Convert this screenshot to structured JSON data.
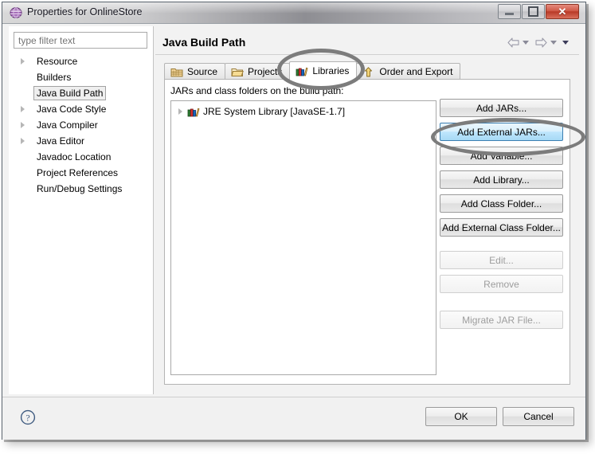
{
  "window": {
    "title": "Properties for OnlineStore",
    "icon": "properties-sphere-icon",
    "controls": {
      "minimize": "minimize-button",
      "maximize": "maximize-button",
      "close_glyph": "✕"
    }
  },
  "sidebar": {
    "filter": {
      "placeholder": "type filter text",
      "value": ""
    },
    "items": [
      {
        "label": "Resource",
        "expandable": true,
        "selected": false
      },
      {
        "label": "Builders",
        "expandable": false,
        "selected": false
      },
      {
        "label": "Java Build Path",
        "expandable": false,
        "selected": true
      },
      {
        "label": "Java Code Style",
        "expandable": true,
        "selected": false
      },
      {
        "label": "Java Compiler",
        "expandable": true,
        "selected": false
      },
      {
        "label": "Java Editor",
        "expandable": true,
        "selected": false
      },
      {
        "label": "Javadoc Location",
        "expandable": false,
        "selected": false
      },
      {
        "label": "Project References",
        "expandable": false,
        "selected": false
      },
      {
        "label": "Run/Debug Settings",
        "expandable": false,
        "selected": false
      }
    ]
  },
  "main": {
    "page_title": "Java Build Path",
    "nav": {
      "back_icon": "back-arrow-icon",
      "back_menu_icon": "chevron-down-icon",
      "forward_icon": "forward-arrow-icon",
      "forward_menu_icon": "chevron-down-icon",
      "view_menu_icon": "view-menu-chevron-icon"
    },
    "tabs": [
      {
        "label": "Source",
        "icon": "source-folder-icon",
        "active": false
      },
      {
        "label": "Projects",
        "icon": "project-folder-icon",
        "active": false
      },
      {
        "label": "Libraries",
        "icon": "libraries-books-icon",
        "active": true
      },
      {
        "label": "Order and Export",
        "icon": "order-export-icon",
        "active": false
      }
    ],
    "list_caption": "JARs and class folders on the build path:",
    "entries": [
      {
        "label": "JRE System Library [JavaSE-1.7]",
        "icon": "jre-library-icon",
        "expandable": true
      }
    ],
    "buttons": [
      {
        "label": "Add JARs...",
        "state": "normal"
      },
      {
        "label": "Add External JARs...",
        "state": "hover"
      },
      {
        "label": "Add Variable...",
        "state": "normal"
      },
      {
        "label": "Add Library...",
        "state": "normal"
      },
      {
        "label": "Add Class Folder...",
        "state": "normal"
      },
      {
        "label": "Add External Class Folder...",
        "state": "normal"
      },
      {
        "label": "Edit...",
        "state": "disabled"
      },
      {
        "label": "Remove",
        "state": "disabled"
      },
      {
        "label": "Migrate JAR File...",
        "state": "disabled"
      }
    ]
  },
  "footer": {
    "help_icon": "help-question-icon",
    "ok_label": "OK",
    "cancel_label": "Cancel"
  },
  "annotations": [
    {
      "name": "libraries-tab-highlight",
      "shape": "ellipse",
      "color": "#7c7c7c"
    },
    {
      "name": "add-external-jars-highlight",
      "shape": "ellipse",
      "color": "#7c7c7c"
    }
  ],
  "colors": {
    "hover_blue": "#bee6fd",
    "hover_border": "#3c7fb1",
    "annotation_gray": "#7c7c7c",
    "close_red": "#b83a27"
  }
}
